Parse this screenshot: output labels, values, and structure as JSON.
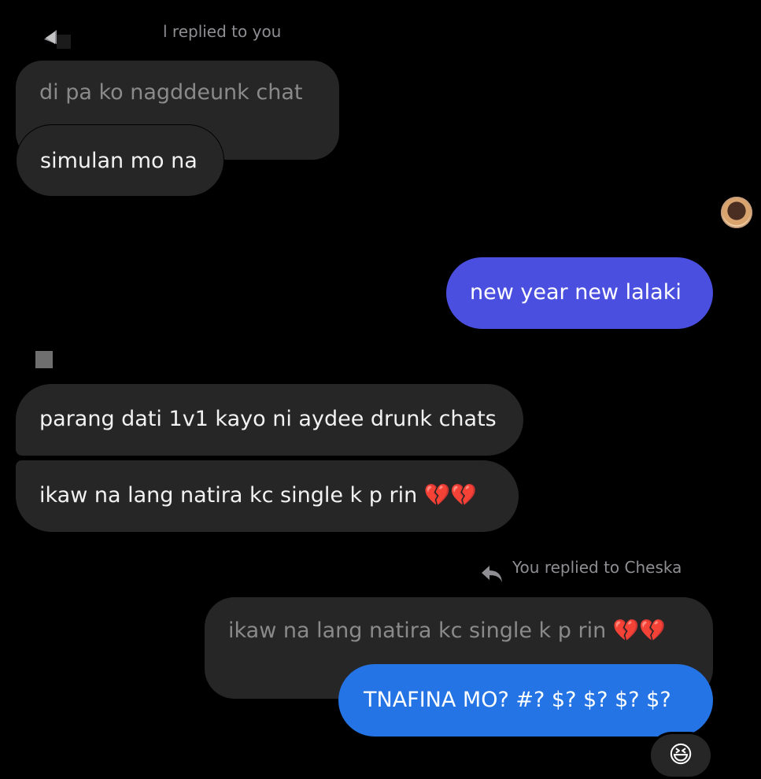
{
  "thread": {
    "top_reply": {
      "meta": "l replied to you",
      "quoted_text": "di pa ko nagddeunk chat",
      "reply_text": "simulan mo na"
    },
    "outgoing_1": {
      "text": "new year new lalaki",
      "color": "#4a4fe0"
    },
    "incoming_1": "parang dati 1v1 kayo ni aydee drunk chats",
    "incoming_2": "ikaw na lang natira kc single k p rin 💔💔",
    "bottom_reply": {
      "meta": "You replied to Cheska",
      "quoted_text": "ikaw na lang natira kc single k p rin 💔💔",
      "reply_text": "TNAFINA MO? #? $? $? $? $?",
      "color": "#2474e6"
    },
    "reaction": "😆"
  },
  "icons": {
    "reply_arrow": "reply-arrow-icon",
    "avatar": "avatar",
    "square": "square-icon"
  }
}
